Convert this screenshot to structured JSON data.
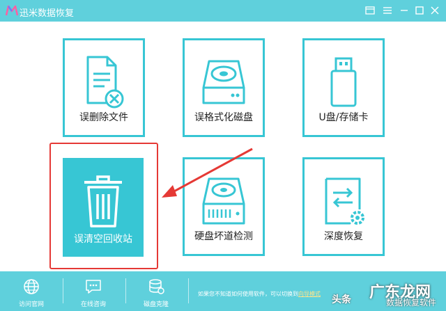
{
  "app": {
    "title": "迅米数据恢复"
  },
  "colors": {
    "accent": "#37c6d4",
    "titlebar": "#5fd0dc",
    "highlight": "#e53935"
  },
  "tiles": [
    {
      "label": "误删除文件",
      "icon": "deleted-file-icon",
      "selected": false
    },
    {
      "label": "误格式化磁盘",
      "icon": "hard-disk-icon",
      "selected": false
    },
    {
      "label": "U盘/存储卡",
      "icon": "usb-drive-icon",
      "selected": false
    },
    {
      "label": "误清空回收站",
      "icon": "trash-icon",
      "selected": true
    },
    {
      "label": "硬盘坏道检测",
      "icon": "disk-scan-icon",
      "selected": false
    },
    {
      "label": "深度恢复",
      "icon": "deep-recovery-icon",
      "selected": false
    }
  ],
  "bottombar": {
    "items": [
      {
        "label": "访问官网",
        "icon": "globe-icon"
      },
      {
        "label": "在线咨询",
        "icon": "chat-icon"
      },
      {
        "label": "磁盘克隆",
        "icon": "database-icon"
      }
    ],
    "note_prefix": "如果您不知道如何使用软件，可以切换到",
    "note_link": "向导模式"
  },
  "watermark": {
    "line1": "头条",
    "line2": "广东龙网",
    "line3": "数据恢复软件"
  }
}
